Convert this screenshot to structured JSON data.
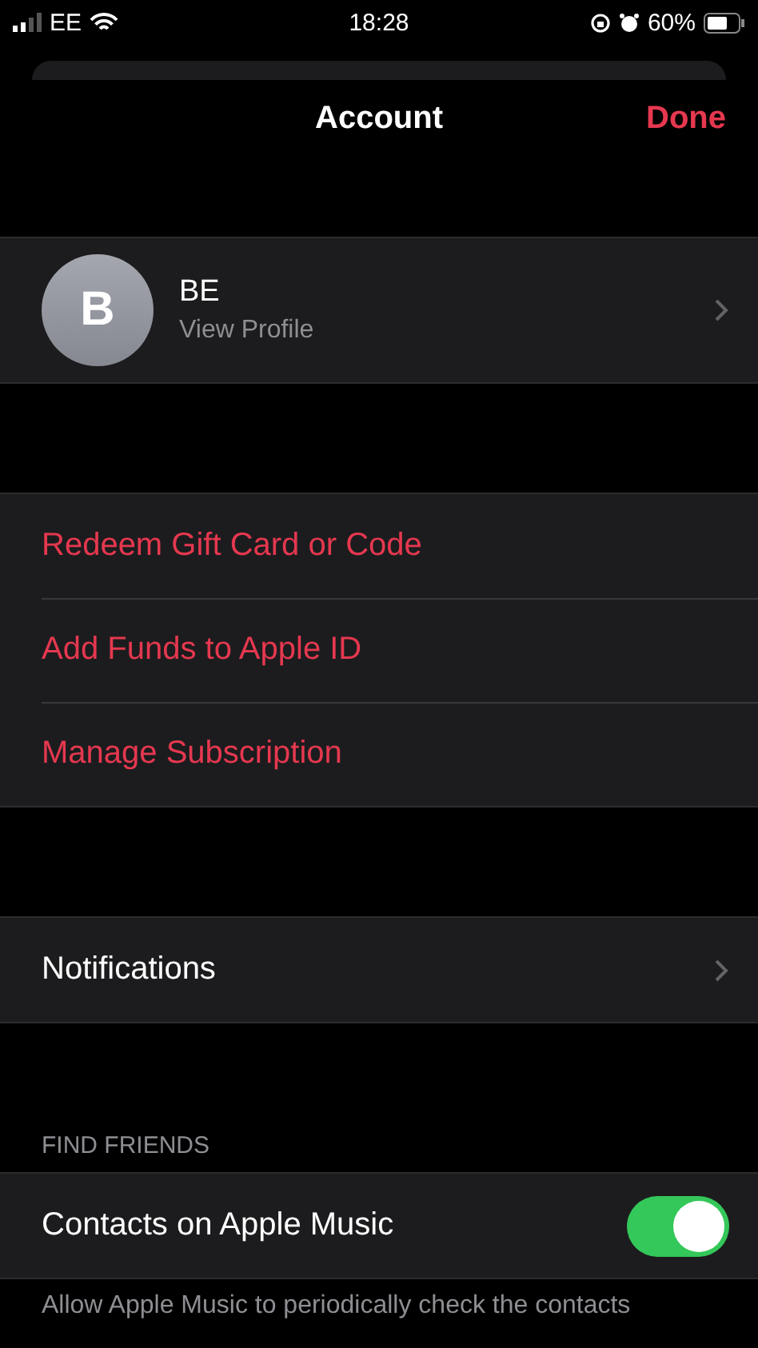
{
  "status_bar": {
    "carrier": "EE",
    "time": "18:28",
    "battery": "60%"
  },
  "nav": {
    "title": "Account",
    "done": "Done"
  },
  "profile": {
    "initial": "B",
    "name": "BE",
    "subtitle": "View Profile"
  },
  "actions": [
    {
      "label": "Redeem Gift Card or Code"
    },
    {
      "label": "Add Funds to Apple ID"
    },
    {
      "label": "Manage Subscription"
    }
  ],
  "notifications": {
    "label": "Notifications"
  },
  "find_friends": {
    "header": "FIND FRIENDS",
    "label": "Contacts on Apple Music",
    "on": true,
    "footer": "Allow Apple Music to periodically check the contacts"
  }
}
